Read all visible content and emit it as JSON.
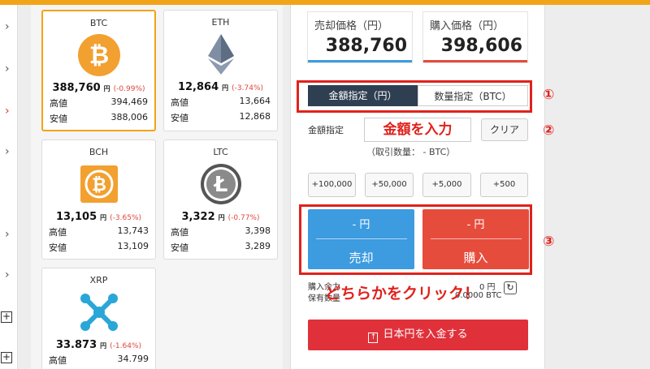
{
  "coins": [
    {
      "symbol": "BTC",
      "price": "388,760",
      "unit": "円",
      "change": "(-0.99%)",
      "high_label": "高値",
      "high": "394,469",
      "low_label": "安値",
      "low": "388,006"
    },
    {
      "symbol": "ETH",
      "price": "12,864",
      "unit": "円",
      "change": "(-3.74%)",
      "high_label": "高値",
      "high": "13,664",
      "low_label": "安値",
      "low": "12,868"
    },
    {
      "symbol": "BCH",
      "price": "13,105",
      "unit": "円",
      "change": "(-3.65%)",
      "high_label": "高値",
      "high": "13,743",
      "low_label": "安値",
      "low": "13,109"
    },
    {
      "symbol": "LTC",
      "price": "3,322",
      "unit": "円",
      "change": "(-0.77%)",
      "high_label": "高値",
      "high": "3,398",
      "low_label": "安値",
      "low": "3,289"
    },
    {
      "symbol": "XRP",
      "price": "33.873",
      "unit": "円",
      "change": "(-1.64%)",
      "high_label": "高値",
      "high": "34.799"
    }
  ],
  "sell_price": {
    "label": "売却価格（円）",
    "value": "388,760"
  },
  "buy_price": {
    "label": "購入価格（円）",
    "value": "398,606"
  },
  "tabs": {
    "amount": "金額指定（円）",
    "quantity": "数量指定（BTC）"
  },
  "amount_label": "金額指定",
  "amount_input": "金額を入力",
  "clear_label": "クリア",
  "trade_qty_note": "（取引数量： - BTC）",
  "quick_amounts": [
    "+100,000",
    "+50,000",
    "+5,000",
    "+500"
  ],
  "sell_button": {
    "yen": "- 円",
    "label": "売却"
  },
  "buy_button": {
    "yen": "- 円",
    "label": "購入"
  },
  "balance": {
    "buy_label": "購入余力",
    "buy_value": "0 円",
    "hold_label": "保有数量",
    "hold_value": "0.0000 BTC"
  },
  "instruction": "どちらかをクリック！",
  "markers": {
    "one": "①",
    "two": "②",
    "three": "③"
  },
  "deposit_label": "日本円を入金する",
  "colors": {
    "accent": "#f2a419",
    "sell": "#3d9be0",
    "buy": "#e64c3c",
    "highlight": "#e0221c"
  }
}
